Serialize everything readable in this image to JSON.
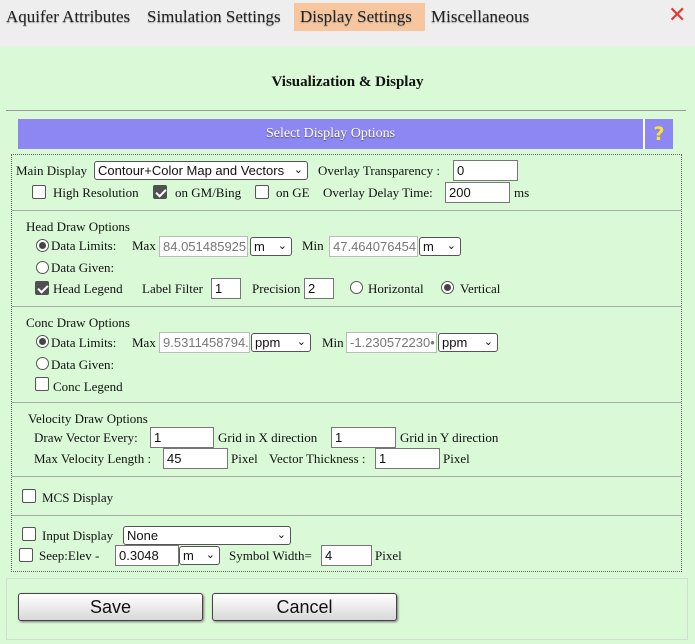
{
  "tabs": [
    "Aquifer Attributes",
    "Simulation Settings",
    "Display Settings",
    "Miscellaneous"
  ],
  "close_glyph": "✕",
  "title": "Visualization & Display",
  "section_bar": "Select Display Options",
  "help_glyph": "?",
  "main": {
    "main_display_label": "Main Display",
    "main_display_value": "Contour+Color Map and Vectors",
    "overlay_transparency_label": "Overlay Transparency :",
    "overlay_transparency_value": "0",
    "high_res_label": "High Resolution",
    "gm_bing_label": "on GM/Bing",
    "ge_label": "on GE",
    "overlay_delay_label": "Overlay Delay Time:",
    "overlay_delay_value": "200",
    "ms_label": "ms"
  },
  "head": {
    "title": "Head Draw Options",
    "data_limits": "Data Limits:",
    "max_label": "Max",
    "max_value": "84.051485925",
    "max_unit": "m",
    "min_label": "Min",
    "min_value": "47.464076454",
    "min_unit": "m",
    "data_given": "Data Given:",
    "legend_label": "Head Legend",
    "label_filter_label": "Label Filter",
    "label_filter_value": "1",
    "precision_label": "Precision",
    "precision_value": "2",
    "horizontal": "Horizontal",
    "vertical": "Vertical"
  },
  "conc": {
    "title": "Conc Draw Options",
    "data_limits": "Data Limits:",
    "max_label": "Max",
    "max_value": "9.5311458794.",
    "max_unit": "ppm",
    "min_label": "Min",
    "min_value": "-1.230572230•",
    "min_unit": "ppm",
    "data_given": "Data Given:",
    "legend_label": "Conc Legend"
  },
  "velocity": {
    "title": "Velocity Draw Options",
    "draw_every_label": "Draw Vector Every:",
    "grid_x_value": "1",
    "grid_x_label": "Grid in X direction",
    "grid_y_value": "1",
    "grid_y_label": "Grid in Y direction",
    "max_len_label": "Max Velocity Length :",
    "max_len_value": "45",
    "pixel_label": "Pixel",
    "thickness_label": "Vector Thickness :",
    "thickness_value": "1",
    "pixel_label2": "Pixel"
  },
  "mcs_label": "MCS Display",
  "input_display": {
    "label": "Input Display",
    "value": "None"
  },
  "seep": {
    "label": "Seep:Elev -",
    "value": "0.3048",
    "unit": "m",
    "symbol_label": "Symbol Width=",
    "symbol_value": "4",
    "pixel_label": "Pixel"
  },
  "buttons": {
    "save": "Save",
    "cancel": "Cancel"
  }
}
